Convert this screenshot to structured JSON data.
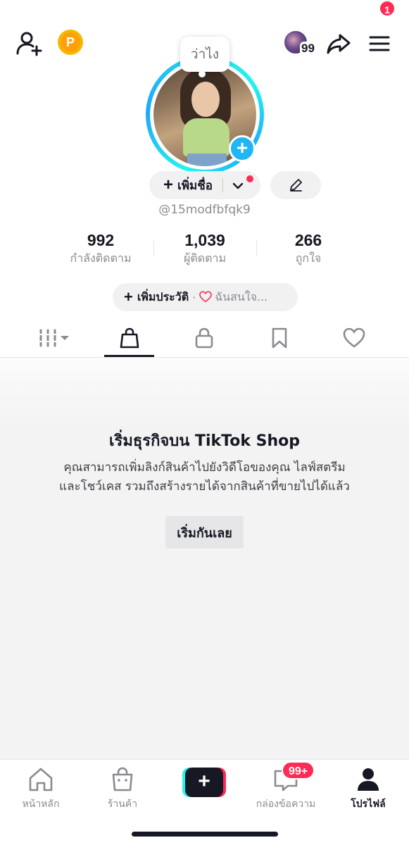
{
  "topbar": {
    "add_friend_icon": "person-add-icon",
    "coin_label": "P",
    "friends_count": "99",
    "share_icon": "share-arrow-icon",
    "menu_icon": "hamburger-menu-icon",
    "menu_badge": "1"
  },
  "profile": {
    "status_bubble": "ว่าไง",
    "add_name_label": "เพิ่มชื่อ",
    "username": "@15modfbfqk9"
  },
  "stats": [
    {
      "value": "992",
      "label": "กำลังติดตาม"
    },
    {
      "value": "1,039",
      "label": "ผู้ติดตาม"
    },
    {
      "value": "266",
      "label": "ถูกใจ"
    }
  ],
  "bio": {
    "add_bio_label": "เพิ่มประวัติ",
    "separator": "·",
    "interest_label": "ฉันสนใจ..."
  },
  "tabs": [
    {
      "icon": "grid-icon",
      "active": false
    },
    {
      "icon": "shopping-bag-icon",
      "active": true
    },
    {
      "icon": "lock-icon",
      "active": false
    },
    {
      "icon": "bookmark-icon",
      "active": false
    },
    {
      "icon": "heart-icon",
      "active": false
    }
  ],
  "shop": {
    "title": "เริ่มธุรกิจบน TikTok Shop",
    "description_line1": "คุณสามารถเพิ่มลิงก์สินค้าไปยังวิดีโอของคุณ ไลฟ์สตรีม",
    "description_line2": "และโชว์เคส รวมถึงสร้างรายได้จากสินค้าที่ขายไปได้แล้ว",
    "start_button": "เริ่มกันเลย"
  },
  "bottom_nav": {
    "home": "หน้าหลัก",
    "shop": "ร้านค้า",
    "create": "+",
    "inbox": "กล่องข้อความ",
    "inbox_badge": "99+",
    "profile": "โปรไฟล์"
  },
  "colors": {
    "accent_red": "#fe2c55",
    "accent_cyan": "#25f4ee",
    "avatar_add_blue": "#20b5f5",
    "text_primary": "#161823",
    "text_secondary": "#8a8b91"
  }
}
